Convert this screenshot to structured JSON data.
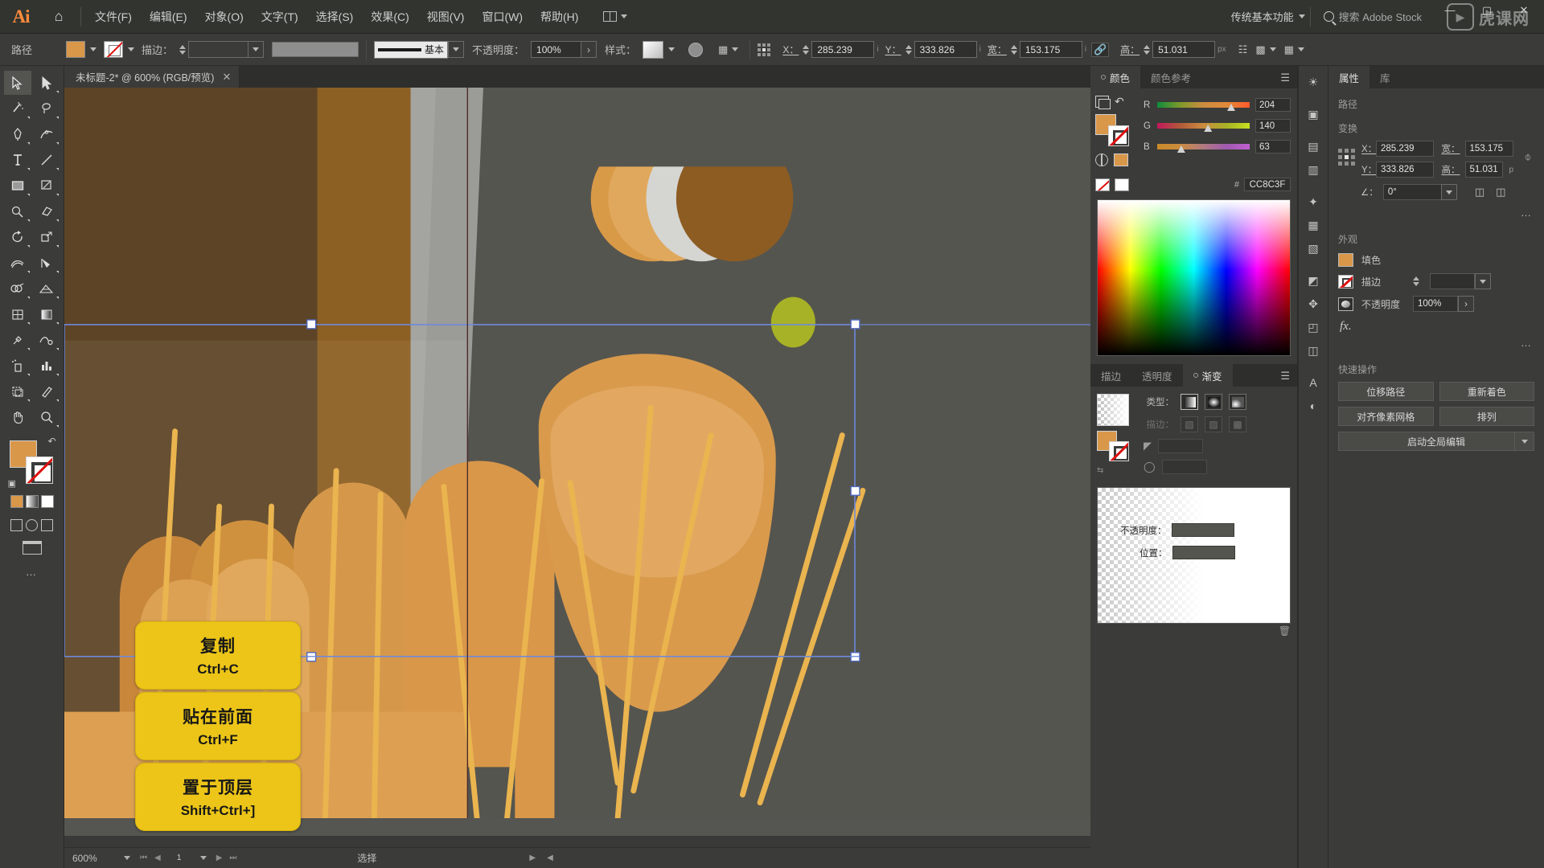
{
  "app": {
    "logo": "Ai",
    "home_icon": "home-icon",
    "arrange_icon": "arrange-documents-icon",
    "workspace": "传统基本功能",
    "search_placeholder": "搜索 Adobe Stock",
    "window_controls": {
      "minimize": "—",
      "maximize": "▢",
      "close": "✕"
    }
  },
  "menubar": {
    "items": [
      {
        "label": "文件(F)"
      },
      {
        "label": "编辑(E)"
      },
      {
        "label": "对象(O)"
      },
      {
        "label": "文字(T)"
      },
      {
        "label": "选择(S)"
      },
      {
        "label": "效果(C)"
      },
      {
        "label": "视图(V)"
      },
      {
        "label": "窗口(W)"
      },
      {
        "label": "帮助(H)"
      }
    ]
  },
  "controlbar": {
    "path_label": "路径",
    "fill_color": "#D9974A",
    "stroke_label": "描边：",
    "stroke_weight": "",
    "profile_label": "基本",
    "opacity_label": "不透明度：",
    "opacity_value": "100%",
    "style_label": "样式：",
    "x_label": "X：",
    "x_value": "285.239",
    "x_unit": "i",
    "y_label": "Y：",
    "y_value": "333.826",
    "y_unit": "i",
    "w_label": "宽：",
    "w_value": "153.175",
    "w_unit": "i",
    "h_label": "高：",
    "h_value": "51.031",
    "h_unit": "px",
    "link_icon": "link-chain-icon",
    "transform_icon": "transform-icon",
    "align_icon": "align-icon",
    "distribute_icon": "distribute-icon"
  },
  "tools": [
    {
      "name": "selection-tool",
      "glyph": "selection",
      "active": true
    },
    {
      "name": "direct-selection-tool",
      "glyph": "direct-selection"
    },
    {
      "name": "magic-wand-tool",
      "glyph": "magic-wand"
    },
    {
      "name": "lasso-tool",
      "glyph": "lasso"
    },
    {
      "name": "pen-tool",
      "glyph": "pen"
    },
    {
      "name": "curvature-tool",
      "glyph": "curvature"
    },
    {
      "name": "type-tool",
      "glyph": "type"
    },
    {
      "name": "line-segment-tool",
      "glyph": "line"
    },
    {
      "name": "rectangle-tool",
      "glyph": "rectangle"
    },
    {
      "name": "paintbrush-tool",
      "glyph": "paintbrush"
    },
    {
      "name": "shaper-tool",
      "glyph": "shaper"
    },
    {
      "name": "eraser-tool",
      "glyph": "eraser"
    },
    {
      "name": "rotate-tool",
      "glyph": "rotate"
    },
    {
      "name": "scale-tool",
      "glyph": "scale"
    },
    {
      "name": "width-tool",
      "glyph": "width"
    },
    {
      "name": "free-transform-tool",
      "glyph": "free-transform"
    },
    {
      "name": "shape-builder-tool",
      "glyph": "shape-builder"
    },
    {
      "name": "perspective-grid-tool",
      "glyph": "perspective"
    },
    {
      "name": "mesh-tool",
      "glyph": "mesh"
    },
    {
      "name": "gradient-tool",
      "glyph": "gradient"
    },
    {
      "name": "eyedropper-tool",
      "glyph": "eyedropper"
    },
    {
      "name": "blend-tool",
      "glyph": "blend"
    },
    {
      "name": "symbol-sprayer-tool",
      "glyph": "symbol-sprayer"
    },
    {
      "name": "column-graph-tool",
      "glyph": "column-graph"
    },
    {
      "name": "artboard-tool",
      "glyph": "artboard"
    },
    {
      "name": "slice-tool",
      "glyph": "slice"
    },
    {
      "name": "hand-tool",
      "glyph": "hand"
    },
    {
      "name": "zoom-tool",
      "glyph": "zoom"
    }
  ],
  "document": {
    "tab_title": "未标题-2* @ 600% (RGB/预览)",
    "close_icon": "close-icon"
  },
  "statusbar": {
    "zoom": "600%",
    "page": "1",
    "status": "选择"
  },
  "color_panel": {
    "tabs": [
      {
        "label": "颜色",
        "active": true
      },
      {
        "label": "颜色参考",
        "active": false
      }
    ],
    "menu_icon": "panel-menu-icon",
    "channels": [
      {
        "label": "R",
        "value": "204",
        "pos": 80
      },
      {
        "label": "G",
        "value": "140",
        "pos": 55
      },
      {
        "label": "B",
        "value": "63",
        "pos": 26
      }
    ],
    "hex_label": "#",
    "hex_value": "CC8C3F",
    "fill_color": "#CC8C3F",
    "none_swatch": "none-swatch-icon",
    "white_swatch": "white-swatch-icon"
  },
  "gradient_panel": {
    "tabs": [
      {
        "label": "描边",
        "active": false
      },
      {
        "label": "透明度",
        "active": false
      },
      {
        "label": "渐变",
        "active": true
      }
    ],
    "menu_icon": "panel-menu-icon",
    "type_label": "类型：",
    "stroke_label": "描边：",
    "angle_label": "angle-icon",
    "aspect_label": "aspect-ratio-icon",
    "angle_value": "",
    "aspect_value": "",
    "opacity_label": "不透明度：",
    "position_label": "位置：",
    "opacity_value": "",
    "position_value": "",
    "delete_icon": "delete-stop-icon"
  },
  "properties_panel": {
    "tabs": [
      {
        "label": "属性",
        "active": true
      },
      {
        "label": "库",
        "active": false
      }
    ],
    "path_section": "路径",
    "transform_section": "变换",
    "x_label": "X：",
    "x_value": "285.239",
    "y_label": "Y：",
    "y_value": "333.826",
    "w_label": "宽：",
    "w_value": "153.175",
    "h_label": "高：",
    "h_value": "51.031",
    "h_unit": "p",
    "lock_icon": "broken-link-icon",
    "angle_label": "∠：",
    "angle_value": "0°",
    "flip_h_icon": "flip-horizontal-icon",
    "flip_v_icon": "flip-vertical-icon",
    "more_icon": "more-options-icon",
    "appearance_section": "外观",
    "fill_label": "填色",
    "stroke_label": "描边",
    "opacity_label": "不透明度",
    "opacity_value": "100%",
    "fx_label": "fx.",
    "quick_actions_section": "快速操作",
    "quick_actions": [
      {
        "label": "位移路径"
      },
      {
        "label": "重新着色"
      },
      {
        "label": "对齐像素网格"
      },
      {
        "label": "排列"
      }
    ],
    "global_edit": "启动全局编辑"
  },
  "icon_rail": [
    {
      "name": "rail-icon-brightness",
      "glyph": "☀"
    },
    {
      "name": "rail-icon-libraries",
      "glyph": "▣"
    },
    {
      "name": "rail-icon-layers",
      "glyph": "▤"
    },
    {
      "name": "rail-icon-swatches",
      "glyph": "▥"
    },
    {
      "name": "rail-icon-brushes",
      "glyph": "✦"
    },
    {
      "name": "rail-icon-symbols",
      "glyph": "▦"
    },
    {
      "name": "rail-icon-align",
      "glyph": "▧"
    },
    {
      "name": "rail-icon-pathfinder",
      "glyph": "◩"
    },
    {
      "name": "rail-icon-transform",
      "glyph": "✥"
    },
    {
      "name": "rail-icon-artboards",
      "glyph": "◰"
    },
    {
      "name": "rail-icon-links",
      "glyph": "◫"
    },
    {
      "name": "rail-icon-character",
      "glyph": "A"
    },
    {
      "name": "rail-icon-opacity",
      "glyph": "◐"
    }
  ],
  "shortcut_cards": [
    {
      "title": "复制",
      "key": "Ctrl+C"
    },
    {
      "title": "贴在前面",
      "key": "Ctrl+F"
    },
    {
      "title": "置于顶层",
      "key": "Shift+Ctrl+]"
    }
  ],
  "watermark": {
    "text": "虎课网",
    "icon": "play-badge-icon"
  },
  "artwork": {
    "background": "#55554F",
    "dark_brown": "#5C4425",
    "mid_brown": "#8B5E23",
    "gray_light": "#9A9A96",
    "gray_mid": "#8D8D89",
    "orange": "#D9974A",
    "orange_light": "#E3AC62",
    "olive": "#A8B226",
    "straw": "#E8B24A"
  }
}
